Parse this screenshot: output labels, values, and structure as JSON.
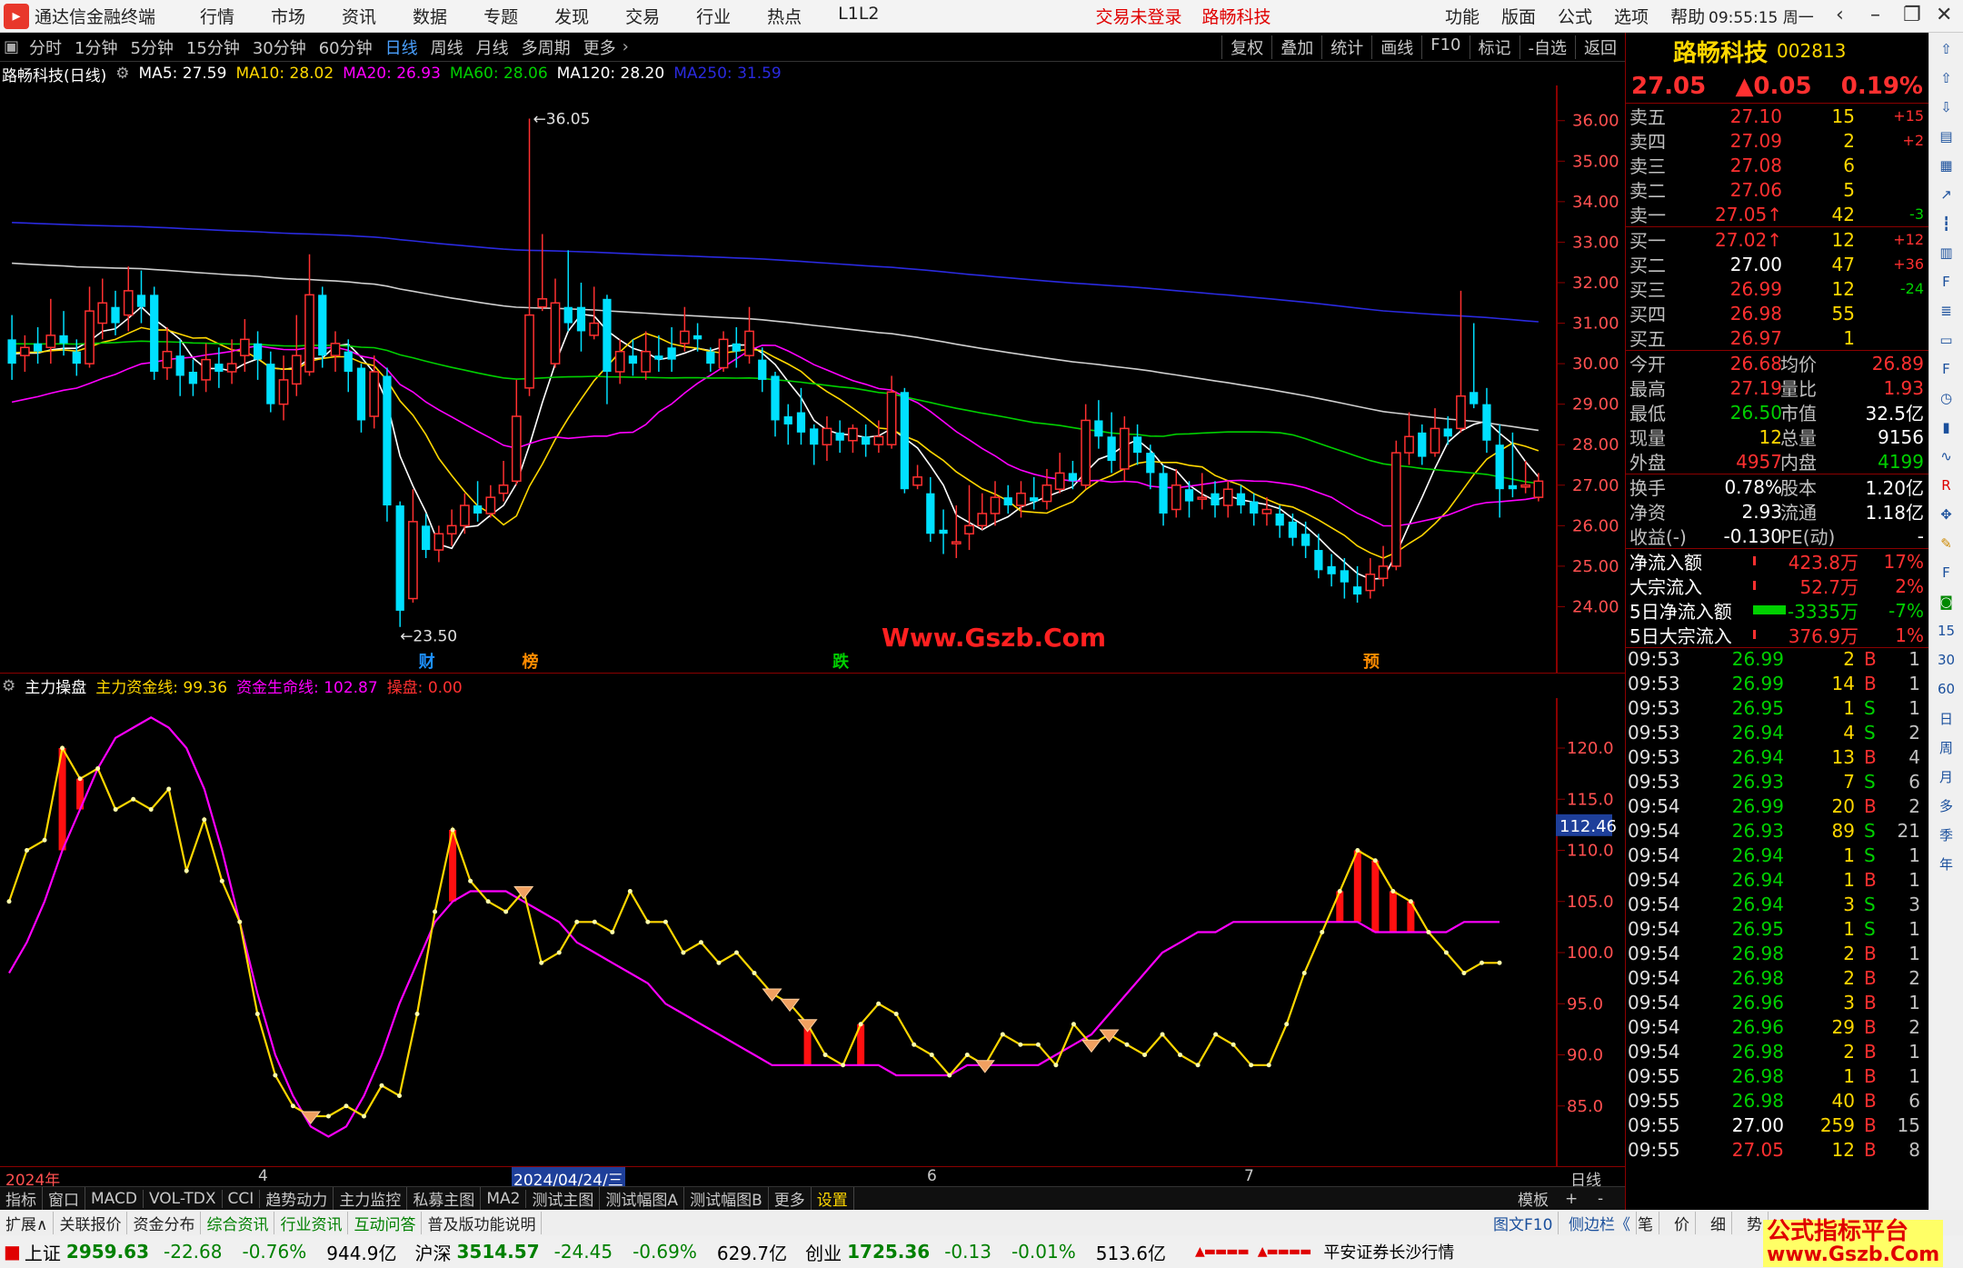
{
  "titlebar": {
    "app": "通达信金融终端",
    "menu": [
      "行情",
      "市场",
      "资讯",
      "数据",
      "专题",
      "发现",
      "交易",
      "行业",
      "热点",
      "L1L2"
    ],
    "alert": "交易未登录",
    "stock": "路畅科技",
    "right_menu": [
      "功能",
      "版面",
      "公式",
      "选项",
      "帮助"
    ],
    "clock": "09:55:15",
    "weekday": "周一"
  },
  "periodbar": {
    "periods": [
      "分时",
      "1分钟",
      "5分钟",
      "15分钟",
      "30分钟",
      "60分钟",
      "日线",
      "周线",
      "月线",
      "多周期",
      "更多"
    ],
    "active": "日线",
    "tools": [
      "复权",
      "叠加",
      "统计",
      "画线",
      "F10",
      "标记",
      "-自选",
      "返回"
    ]
  },
  "mainchart": {
    "name": "路畅科技(日线)",
    "ma": [
      {
        "label": "MA5: 27.59",
        "color": "#ffffff"
      },
      {
        "label": "MA10: 28.02",
        "color": "#ffd700"
      },
      {
        "label": "MA20: 26.93",
        "color": "#ff00ff"
      },
      {
        "label": "MA60: 28.06",
        "color": "#00d000"
      },
      {
        "label": "MA120: 28.20",
        "color": "#ffffff"
      },
      {
        "label": "MA250: 31.59",
        "color": "#2a2adf"
      }
    ],
    "high_label": "36.05",
    "low_label": "23.50",
    "markers": [
      {
        "t": "财",
        "color": "#1e90ff"
      },
      {
        "t": "榜",
        "color": "#ff8c00"
      },
      {
        "t": "跌",
        "color": "#00d000"
      },
      {
        "t": "预",
        "color": "#ff8c00"
      }
    ],
    "yaxis": [
      "36.00",
      "35.00",
      "34.00",
      "33.00",
      "32.00",
      "31.00",
      "30.00",
      "29.00",
      "28.00",
      "27.00",
      "26.00",
      "25.00",
      "24.00"
    ]
  },
  "subchart": {
    "name": "主力操盘",
    "lines": [
      {
        "label": "主力资金线: 99.36",
        "color": "#ffd700"
      },
      {
        "label": "资金生命线: 102.87",
        "color": "#ff00ff"
      },
      {
        "label": "操盘: 0.00",
        "color": "#ff3030"
      }
    ],
    "yaxis": [
      "120.0",
      "115.0",
      "110.0",
      "105.0",
      "100.0",
      "95.0",
      "90.0",
      "85.0"
    ],
    "current": "112.46"
  },
  "dateaxis": {
    "labels": [
      "2024年",
      "4",
      "2024/04/24/三",
      "6",
      "7"
    ],
    "right": "日线"
  },
  "tabbar": {
    "tabs": [
      "指标",
      "窗口",
      "MACD",
      "VOL-TDX",
      "CCI",
      "趋势动力",
      "主力监控",
      "私募主图",
      "MA2",
      "测试主图",
      "测试幅图A",
      "测试幅图B",
      "更多",
      "设置"
    ],
    "right": [
      "模板",
      "+",
      "-"
    ]
  },
  "bottomtabs": {
    "tabs": [
      "扩展∧",
      "关联报价",
      "资金分布",
      "综合资讯",
      "行业资讯",
      "互动问答",
      "普及版功能说明"
    ],
    "right": [
      "图文F10",
      "侧边栏《",
      "笔",
      "价",
      "细",
      "势"
    ]
  },
  "statusbar": {
    "indices": [
      {
        "name": "上证",
        "val": "2959.63",
        "chg": "-22.68",
        "pct": "-0.76%",
        "amt": "944.9亿"
      },
      {
        "name": "沪深",
        "val": "3514.57",
        "chg": "-24.45",
        "pct": "-0.69%",
        "amt": "629.7亿"
      },
      {
        "name": "创业",
        "val": "1725.36",
        "chg": "-0.13",
        "pct": "-0.01%",
        "amt": "513.6亿"
      }
    ],
    "broker": "平安证券长沙行情"
  },
  "quote": {
    "name": "路畅科技",
    "code": "002813",
    "price": "27.05",
    "change": "▲0.05",
    "pct": "0.19%",
    "asks": [
      {
        "l": "卖五",
        "p": "27.10",
        "q": "15",
        "d": "+15"
      },
      {
        "l": "卖四",
        "p": "27.09",
        "q": "2",
        "d": "+2"
      },
      {
        "l": "卖三",
        "p": "27.08",
        "q": "6",
        "d": ""
      },
      {
        "l": "卖二",
        "p": "27.06",
        "q": "5",
        "d": ""
      },
      {
        "l": "卖一",
        "p": "27.05↑",
        "q": "42",
        "d": "-3"
      }
    ],
    "bids": [
      {
        "l": "买一",
        "p": "27.02↑",
        "q": "12",
        "d": "+12"
      },
      {
        "l": "买二",
        "p": "27.00",
        "q": "47",
        "d": "+36"
      },
      {
        "l": "买三",
        "p": "26.99",
        "q": "12",
        "d": "-24"
      },
      {
        "l": "买四",
        "p": "26.98",
        "q": "55",
        "d": ""
      },
      {
        "l": "买五",
        "p": "26.97",
        "q": "1",
        "d": ""
      }
    ],
    "stats1": [
      {
        "a": "今开",
        "av": "26.68",
        "b": "均价",
        "bv": "26.89"
      },
      {
        "a": "最高",
        "av": "27.19",
        "b": "量比",
        "bv": "1.93"
      },
      {
        "a": "最低",
        "av": "26.50",
        "b": "市值",
        "bv": "32.5亿"
      },
      {
        "a": "现量",
        "av": "12",
        "b": "总量",
        "bv": "9156"
      },
      {
        "a": "外盘",
        "av": "4957",
        "b": "内盘",
        "bv": "4199"
      }
    ],
    "stats2": [
      {
        "a": "换手",
        "av": "0.78%",
        "b": "股本",
        "bv": "1.20亿"
      },
      {
        "a": "净资",
        "av": "2.93",
        "b": "流通",
        "bv": "1.18亿"
      },
      {
        "a": "收益(-)",
        "av": "-0.130",
        "b": "PE(动)",
        "bv": "-"
      }
    ],
    "flows": [
      {
        "l": "净流入额",
        "v": "423.8万",
        "p": "17%"
      },
      {
        "l": "大宗流入",
        "v": "52.7万",
        "p": "2%"
      },
      {
        "l": "5日净流入额",
        "v": "-3335万",
        "p": "-7%"
      },
      {
        "l": "5日大宗流入",
        "v": "376.9万",
        "p": "1%"
      }
    ],
    "ticks": [
      [
        "09:53",
        "26.99",
        "2",
        "B",
        "1"
      ],
      [
        "09:53",
        "26.99",
        "14",
        "B",
        "1"
      ],
      [
        "09:53",
        "26.95",
        "1",
        "S",
        "1"
      ],
      [
        "09:53",
        "26.94",
        "4",
        "S",
        "2"
      ],
      [
        "09:53",
        "26.94",
        "13",
        "B",
        "4"
      ],
      [
        "09:53",
        "26.93",
        "7",
        "S",
        "6"
      ],
      [
        "09:54",
        "26.99",
        "20",
        "B",
        "2"
      ],
      [
        "09:54",
        "26.93",
        "89",
        "S",
        "21"
      ],
      [
        "09:54",
        "26.94",
        "1",
        "S",
        "1"
      ],
      [
        "09:54",
        "26.94",
        "1",
        "B",
        "1"
      ],
      [
        "09:54",
        "26.94",
        "3",
        "S",
        "3"
      ],
      [
        "09:54",
        "26.95",
        "1",
        "S",
        "1"
      ],
      [
        "09:54",
        "26.98",
        "2",
        "B",
        "1"
      ],
      [
        "09:54",
        "26.98",
        "2",
        "B",
        "2"
      ],
      [
        "09:54",
        "26.96",
        "3",
        "B",
        "1"
      ],
      [
        "09:54",
        "26.96",
        "29",
        "B",
        "2"
      ],
      [
        "09:54",
        "26.98",
        "2",
        "B",
        "1"
      ],
      [
        "09:55",
        "26.98",
        "1",
        "B",
        "1"
      ],
      [
        "09:55",
        "26.98",
        "40",
        "B",
        "6"
      ],
      [
        "09:55",
        "27.00",
        "259",
        "B",
        "15"
      ],
      [
        "09:55",
        "27.05",
        "12",
        "B",
        "8"
      ]
    ]
  },
  "iconbar": [
    "15",
    "30",
    "60",
    "日",
    "周",
    "月",
    "多",
    "季",
    "年"
  ],
  "watermark": "Www.Gszb.Com",
  "watermark2": {
    "top": "公式指标平台",
    "bottom": "www.Gszb.Com"
  },
  "chart_data": {
    "type": "candlestick",
    "title": "路畅科技(日线)",
    "ylim": [
      23.5,
      36.05
    ],
    "x": "daily bars 2024-03 to 2024-07",
    "values_note": "",
    "candles": [
      [
        30.6,
        30.0,
        29.6,
        31.2
      ],
      [
        30.2,
        30.4,
        29.8,
        30.7
      ],
      [
        30.5,
        30.3,
        30.0,
        30.9
      ],
      [
        30.4,
        30.7,
        30.0,
        31.6
      ],
      [
        30.7,
        30.5,
        30.2,
        31.3
      ],
      [
        30.3,
        30.0,
        29.7,
        30.6
      ],
      [
        30.0,
        31.3,
        29.9,
        31.9
      ],
      [
        31.0,
        31.5,
        30.6,
        32.1
      ],
      [
        31.4,
        31.0,
        30.7,
        31.8
      ],
      [
        31.2,
        31.8,
        30.8,
        32.4
      ],
      [
        31.7,
        31.4,
        31.0,
        32.3
      ],
      [
        31.7,
        29.8,
        29.6,
        31.9
      ],
      [
        29.9,
        30.3,
        29.6,
        30.9
      ],
      [
        30.2,
        29.7,
        29.2,
        30.6
      ],
      [
        29.8,
        29.5,
        29.2,
        30.1
      ],
      [
        29.6,
        30.1,
        29.3,
        30.5
      ],
      [
        30.0,
        29.8,
        29.4,
        30.4
      ],
      [
        29.8,
        30.0,
        29.5,
        30.6
      ],
      [
        30.2,
        30.6,
        29.8,
        31.1
      ],
      [
        30.5,
        30.1,
        29.6,
        30.8
      ],
      [
        30.0,
        29.0,
        28.8,
        30.3
      ],
      [
        29.0,
        29.6,
        28.6,
        30.2
      ],
      [
        29.5,
        30.2,
        29.2,
        31.2
      ],
      [
        29.8,
        31.7,
        29.7,
        32.7
      ],
      [
        31.7,
        30.2,
        29.9,
        31.9
      ],
      [
        30.2,
        30.5,
        29.8,
        30.8
      ],
      [
        30.3,
        29.8,
        29.3,
        30.6
      ],
      [
        29.9,
        28.6,
        28.3,
        30.0
      ],
      [
        28.7,
        29.8,
        28.4,
        30.2
      ],
      [
        29.7,
        26.5,
        26.1,
        29.9
      ],
      [
        26.5,
        23.9,
        23.5,
        26.6
      ],
      [
        24.2,
        26.1,
        24.1,
        26.9
      ],
      [
        26.0,
        25.4,
        25.2,
        26.3
      ],
      [
        25.4,
        25.8,
        25.1,
        26.0
      ],
      [
        25.8,
        26.0,
        25.5,
        26.4
      ],
      [
        26.0,
        26.5,
        25.8,
        26.8
      ],
      [
        26.5,
        26.3,
        26.1,
        27.1
      ],
      [
        26.3,
        26.7,
        26.2,
        27.0
      ],
      [
        26.8,
        27.0,
        26.6,
        27.6
      ],
      [
        27.1,
        28.7,
        27.0,
        29.6
      ],
      [
        29.4,
        31.2,
        29.2,
        36.05
      ],
      [
        31.4,
        31.6,
        31.3,
        33.2
      ],
      [
        30.0,
        31.5,
        29.9,
        32.1
      ],
      [
        31.4,
        31.0,
        30.8,
        32.8
      ],
      [
        31.4,
        30.8,
        30.3,
        32.0
      ],
      [
        30.7,
        31.0,
        30.6,
        31.9
      ],
      [
        31.6,
        29.8,
        29.0,
        31.7
      ],
      [
        29.8,
        30.3,
        29.5,
        30.6
      ],
      [
        30.2,
        30.0,
        29.7,
        30.6
      ],
      [
        29.8,
        30.3,
        29.6,
        30.8
      ],
      [
        30.2,
        30.1,
        29.8,
        30.7
      ],
      [
        30.4,
        30.1,
        29.8,
        30.9
      ],
      [
        30.5,
        30.8,
        30.3,
        31.4
      ],
      [
        30.7,
        30.6,
        30.3,
        31.0
      ],
      [
        30.3,
        30.0,
        29.8,
        30.4
      ],
      [
        29.9,
        30.6,
        29.8,
        30.8
      ],
      [
        30.5,
        30.3,
        29.9,
        30.9
      ],
      [
        30.2,
        30.8,
        30.0,
        31.4
      ],
      [
        30.1,
        29.6,
        29.3,
        30.4
      ],
      [
        29.7,
        28.6,
        28.2,
        29.8
      ],
      [
        28.7,
        28.5,
        28.0,
        29.0
      ],
      [
        28.8,
        28.3,
        28.0,
        29.4
      ],
      [
        28.4,
        28.0,
        27.5,
        28.5
      ],
      [
        28.0,
        28.4,
        27.6,
        28.7
      ],
      [
        28.3,
        28.1,
        27.8,
        28.6
      ],
      [
        28.1,
        28.4,
        27.8,
        28.5
      ],
      [
        28.2,
        28.0,
        27.7,
        28.5
      ],
      [
        28.0,
        28.2,
        27.8,
        28.6
      ],
      [
        28.0,
        29.3,
        27.9,
        29.7
      ],
      [
        29.3,
        26.9,
        26.8,
        29.4
      ],
      [
        27.0,
        27.2,
        26.9,
        27.5
      ],
      [
        26.8,
        25.8,
        25.6,
        27.2
      ],
      [
        25.9,
        25.8,
        25.3,
        26.4
      ],
      [
        25.6,
        25.6,
        25.2,
        26.5
      ],
      [
        25.8,
        26.0,
        25.4,
        27.0
      ],
      [
        26.0,
        26.3,
        25.9,
        26.8
      ],
      [
        26.3,
        26.7,
        26.0,
        27.1
      ],
      [
        26.7,
        26.5,
        26.3,
        27.0
      ],
      [
        26.5,
        26.8,
        26.2,
        27.1
      ],
      [
        26.7,
        26.6,
        26.4,
        27.2
      ],
      [
        26.6,
        27.0,
        26.4,
        27.4
      ],
      [
        26.9,
        27.3,
        26.8,
        27.8
      ],
      [
        27.3,
        27.1,
        26.9,
        27.6
      ],
      [
        27.0,
        28.6,
        26.9,
        29.0
      ],
      [
        28.6,
        28.2,
        27.9,
        29.1
      ],
      [
        28.2,
        27.6,
        27.3,
        28.8
      ],
      [
        27.4,
        28.4,
        27.1,
        28.7
      ],
      [
        28.2,
        27.8,
        27.5,
        28.5
      ],
      [
        27.8,
        27.3,
        26.9,
        28.0
      ],
      [
        27.3,
        26.3,
        26.0,
        27.5
      ],
      [
        26.4,
        27.0,
        26.2,
        27.4
      ],
      [
        26.9,
        26.6,
        26.2,
        27.1
      ],
      [
        26.7,
        26.7,
        26.4,
        27.3
      ],
      [
        26.8,
        26.5,
        26.2,
        27.1
      ],
      [
        26.5,
        26.9,
        26.2,
        27.1
      ],
      [
        26.8,
        26.5,
        26.3,
        27.0
      ],
      [
        26.6,
        26.3,
        26.0,
        26.8
      ],
      [
        26.3,
        26.4,
        26.0,
        26.7
      ],
      [
        26.3,
        26.0,
        25.7,
        26.5
      ],
      [
        26.1,
        25.7,
        25.5,
        26.3
      ],
      [
        25.8,
        25.5,
        25.2,
        26.1
      ],
      [
        25.4,
        24.9,
        24.7,
        25.8
      ],
      [
        25.0,
        24.8,
        24.5,
        25.3
      ],
      [
        24.9,
        24.6,
        24.2,
        25.2
      ],
      [
        24.5,
        24.3,
        24.1,
        25.0
      ],
      [
        24.4,
        24.8,
        24.2,
        25.2
      ],
      [
        24.7,
        25.0,
        24.5,
        25.5
      ],
      [
        25.0,
        27.8,
        24.9,
        28.1
      ],
      [
        27.8,
        28.2,
        27.5,
        28.8
      ],
      [
        28.3,
        27.7,
        27.5,
        28.5
      ],
      [
        27.8,
        28.4,
        27.7,
        28.9
      ],
      [
        28.4,
        28.2,
        28.0,
        28.7
      ],
      [
        28.4,
        29.2,
        28.3,
        31.8
      ],
      [
        29.3,
        29.0,
        28.9,
        31.0
      ],
      [
        29.0,
        28.1,
        27.8,
        29.4
      ],
      [
        28.0,
        26.9,
        26.2,
        28.5
      ],
      [
        27.0,
        26.9,
        26.7,
        28.3
      ],
      [
        27.0,
        27.0,
        26.8,
        27.6
      ],
      [
        26.7,
        27.1,
        26.6,
        27.3
      ]
    ],
    "sub": {
      "yellow": [
        105,
        110,
        111,
        120,
        117,
        118,
        114,
        115,
        114,
        116,
        108,
        113,
        107,
        103,
        94,
        88,
        85,
        84,
        84,
        85,
        84,
        87,
        86,
        94,
        104,
        112,
        107,
        105,
        104,
        106,
        99,
        100,
        103,
        103,
        102,
        106,
        103,
        103,
        100,
        101,
        99,
        100,
        98,
        96,
        95,
        93,
        90,
        89,
        93,
        95,
        94,
        91,
        90,
        88,
        90,
        89,
        92,
        91,
        91,
        89,
        93,
        91,
        92,
        91,
        90,
        92,
        90,
        89,
        92,
        91,
        89,
        89,
        93,
        98,
        102,
        106,
        110,
        109,
        106,
        105,
        102,
        100,
        98,
        99,
        99
      ],
      "magenta": [
        98,
        101,
        105,
        110,
        114,
        118,
        121,
        122,
        123,
        122,
        120,
        116,
        110,
        103,
        96,
        90,
        86,
        83,
        82,
        83,
        86,
        90,
        95,
        99,
        103,
        105,
        106,
        106,
        106,
        105,
        104,
        103,
        101,
        100,
        99,
        98,
        97,
        95,
        94,
        93,
        92,
        91,
        90,
        89,
        89,
        89,
        89,
        89,
        89,
        89,
        88,
        88,
        88,
        88,
        89,
        89,
        89,
        89,
        89,
        90,
        91,
        92,
        94,
        96,
        98,
        100,
        101,
        102,
        102,
        103,
        103,
        103,
        103,
        103,
        103,
        103,
        103,
        102,
        102,
        102,
        102,
        102,
        103,
        103,
        103
      ]
    }
  }
}
